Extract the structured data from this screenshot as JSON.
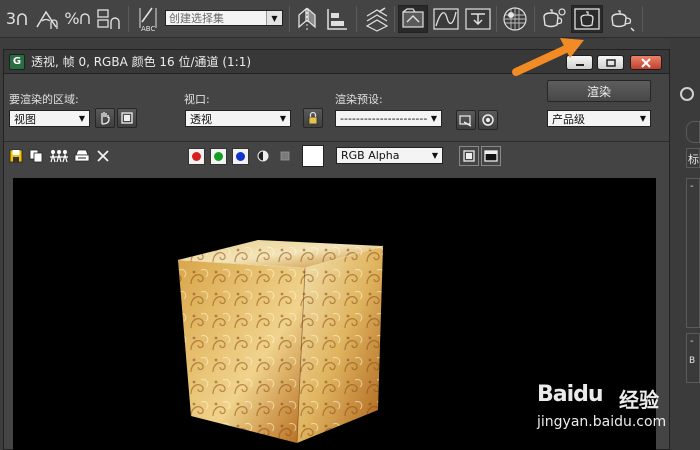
{
  "toolbar": {
    "selection_set_placeholder": "创建选择集",
    "snap_label": "3",
    "icons": [
      "snap-3d-icon",
      "angle-snap-icon",
      "percent-snap-icon",
      "spinner-snap-icon",
      "edit-named-selection-icon",
      "mirror-icon",
      "align-icon",
      "layer-manager-icon",
      "scene-explorer-icon",
      "curve-editor-icon",
      "schematic-view-icon",
      "material-editor-icon",
      "render-setup-icon",
      "rendered-frame-window-icon",
      "render-production-icon"
    ]
  },
  "render_window": {
    "title": "透视, 帧 0, RGBA 颜色 16 位/通道 (1:1)",
    "app_icon_letter": "G",
    "area_label": "要渲染的区域:",
    "area_value": "视图",
    "viewport_label": "视口:",
    "viewport_value": "透视",
    "preset_label": "渲染预设:",
    "preset_value": "-------------------------",
    "render_button": "渲染",
    "quality_value": "产品级",
    "channel_value": "RGB Alpha",
    "channel_colors": [
      "#d62020",
      "#13a020",
      "#1033d0"
    ]
  },
  "side_panel": {
    "tab_label": "标",
    "item_label": "B"
  },
  "watermark": {
    "brand": "Baidu",
    "cn": "经验",
    "url": "jingyan.baidu.com"
  },
  "colors": {
    "accent_arrow": "#f28a25",
    "toolbar_bg": "#444444",
    "viewport_bg": "#000000"
  }
}
